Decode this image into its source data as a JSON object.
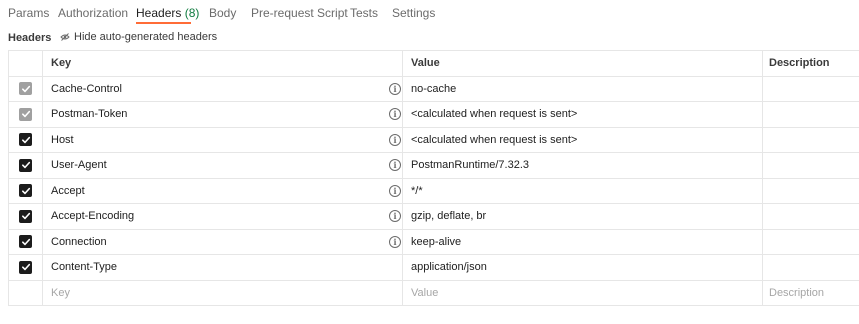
{
  "tabs": [
    {
      "label": "Params"
    },
    {
      "label": "Authorization"
    },
    {
      "label": "Headers",
      "count": "(8)"
    },
    {
      "label": "Body"
    },
    {
      "label": "Pre-request Script"
    },
    {
      "label": "Tests"
    },
    {
      "label": "Settings"
    }
  ],
  "subbar": {
    "title": "Headers",
    "toggle_label": "Hide auto-generated headers",
    "toggle_icon": "eye-off-icon"
  },
  "table": {
    "headers": {
      "key": "Key",
      "value": "Value",
      "description": "Description"
    },
    "rows": [
      {
        "key": "Cache-Control",
        "value": "no-cache",
        "checked": true,
        "auto": true
      },
      {
        "key": "Postman-Token",
        "value": "<calculated when request is sent>",
        "checked": true,
        "auto": true
      },
      {
        "key": "Host",
        "value": "<calculated when request is sent>",
        "checked": true,
        "auto": false
      },
      {
        "key": "User-Agent",
        "value": "PostmanRuntime/7.32.3",
        "checked": true,
        "auto": false
      },
      {
        "key": "Accept",
        "value": "*/*",
        "checked": true,
        "auto": false
      },
      {
        "key": "Accept-Encoding",
        "value": "gzip, deflate, br",
        "checked": true,
        "auto": false
      },
      {
        "key": "Connection",
        "value": "keep-alive",
        "checked": true,
        "auto": false
      },
      {
        "key": "Content-Type",
        "value": "application/json",
        "checked": true,
        "auto": false
      }
    ],
    "new_row": {
      "key_placeholder": "Key",
      "value_placeholder": "Value",
      "description_placeholder": "Description"
    }
  },
  "colors": {
    "accent": "#ff6c37",
    "count": "#0f7b3f",
    "check": "#1c1c1c",
    "check_disabled": "#a0a0a0"
  }
}
